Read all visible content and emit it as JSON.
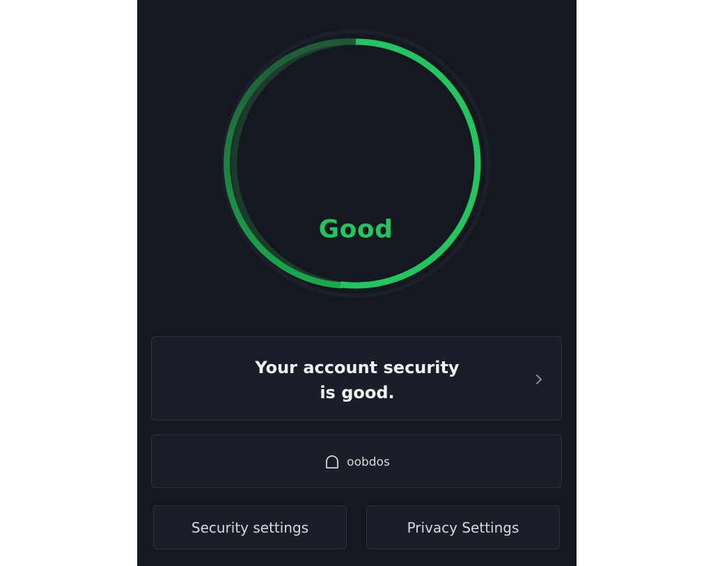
{
  "security_score": {
    "label": "Good",
    "progress": 0.52,
    "accent_color": "#22c55e"
  },
  "status_card": {
    "line1": "Your account security",
    "line2": "is good.",
    "chevron_icon": "chevron-right-icon"
  },
  "item_card": {
    "icon": "bell-icon",
    "label": "oobdos"
  },
  "buttons": {
    "security_settings": "Security settings",
    "privacy_settings": "Privacy Settings"
  }
}
